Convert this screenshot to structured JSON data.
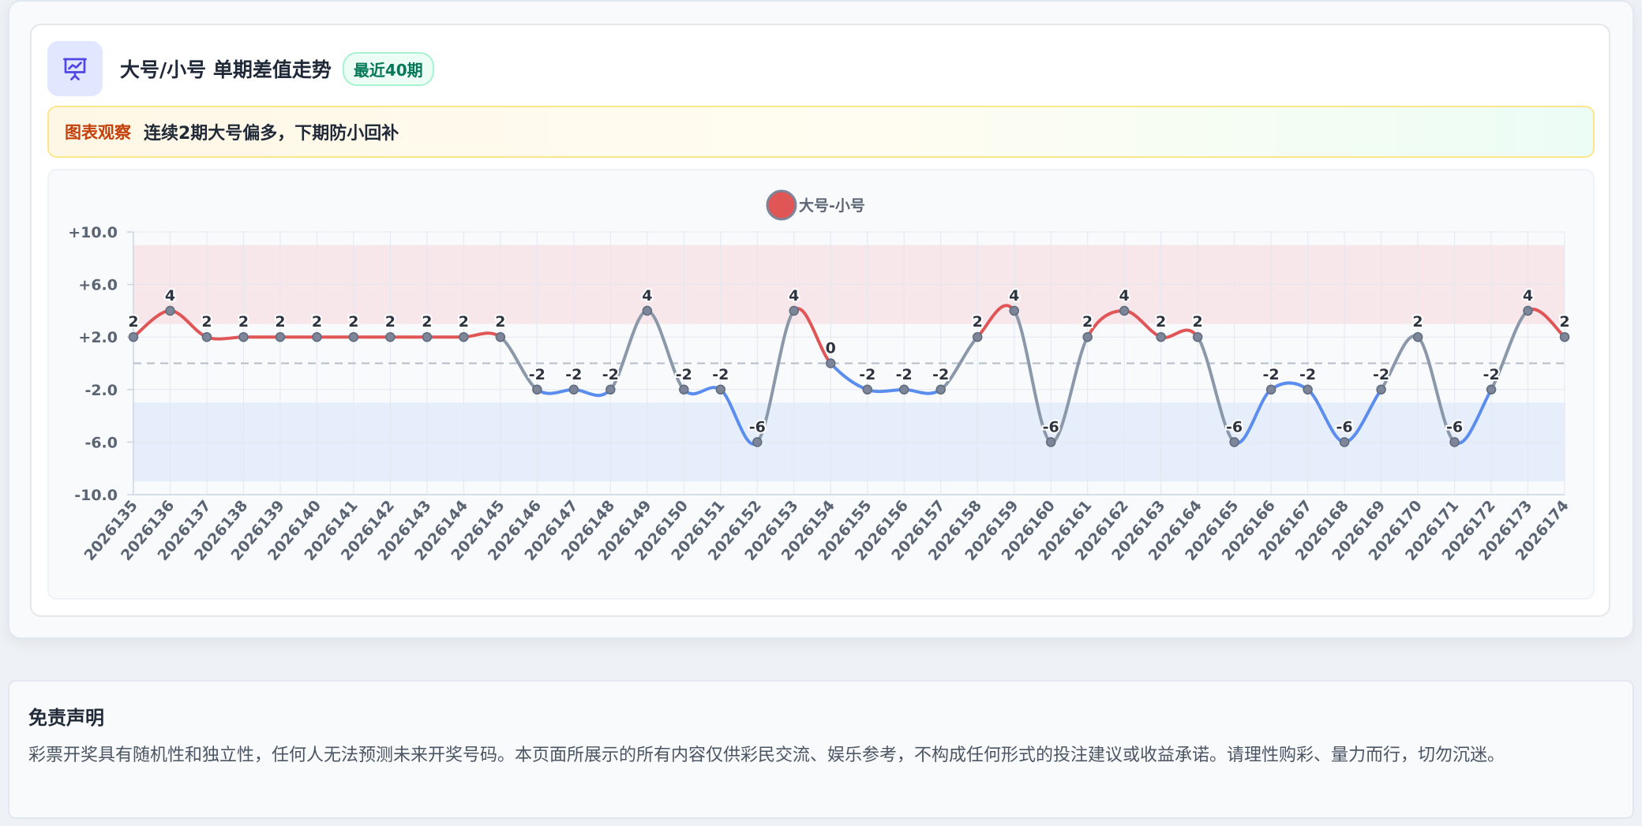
{
  "header": {
    "title": "大号/小号 单期差值走势",
    "badge": "最近40期"
  },
  "observation": {
    "label": "图表观察",
    "text": "连续2期大号偏多，下期防小回补"
  },
  "disclaimer": {
    "title": "免责声明",
    "text": "彩票开奖具有随机性和独立性，任何人无法预测未来开奖号码。本页面所展示的所有内容仅供彩民交流、娱乐参考，不构成任何形式的投注建议或收益承诺。请理性购彩、量力而行，切勿沉迷。"
  },
  "colors": {
    "positive": "#e05555",
    "negative": "#5b8def",
    "neutral": "#8a98aa",
    "accent_icon": "#4f46e5"
  },
  "chart_data": {
    "type": "line",
    "series": [
      {
        "name": "大号-小号",
        "values": [
          2,
          4,
          2,
          2,
          2,
          2,
          2,
          2,
          2,
          2,
          2,
          -2,
          -2,
          -2,
          4,
          -2,
          -2,
          -6,
          4,
          0,
          -2,
          -2,
          -2,
          2,
          4,
          -6,
          2,
          4,
          2,
          2,
          -6,
          -2,
          -2,
          -6,
          -2,
          2,
          -6,
          -2,
          4,
          2
        ]
      }
    ],
    "x": [
      "2026135",
      "2026136",
      "2026137",
      "2026138",
      "2026139",
      "2026140",
      "2026141",
      "2026142",
      "2026143",
      "2026144",
      "2026145",
      "2026146",
      "2026147",
      "2026148",
      "2026149",
      "2026150",
      "2026151",
      "2026152",
      "2026153",
      "2026154",
      "2026155",
      "2026156",
      "2026157",
      "2026158",
      "2026159",
      "2026160",
      "2026161",
      "2026162",
      "2026163",
      "2026164",
      "2026165",
      "2026166",
      "2026167",
      "2026168",
      "2026169",
      "2026170",
      "2026171",
      "2026172",
      "2026173",
      "2026174"
    ],
    "yticks": [
      "+10.0",
      "+6.0",
      "+2.0",
      "-2.0",
      "-6.0",
      "-10.0"
    ],
    "ylim": [
      -10,
      10
    ],
    "bands": [
      {
        "from": 3,
        "to": 9,
        "color": "#f7e6ea"
      },
      {
        "from": -9,
        "to": -3,
        "color": "#e7eefb"
      }
    ],
    "zero_line": true,
    "legend": "top-center",
    "grid": true
  }
}
